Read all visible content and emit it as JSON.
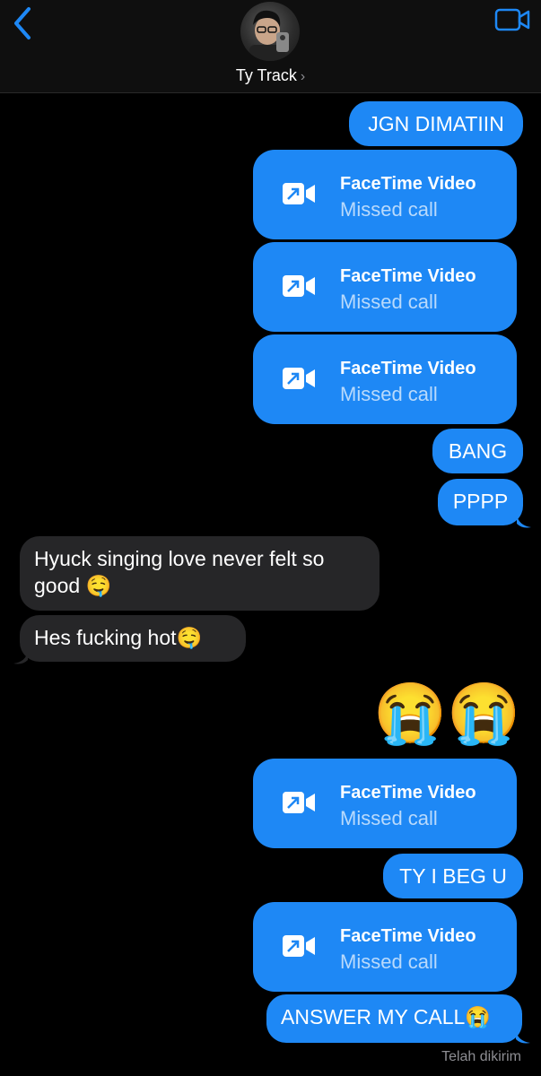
{
  "header": {
    "contact_name": "Ty Track",
    "chevron": "›",
    "back_icon": "chevron-left-icon",
    "video_icon": "video-camera-icon"
  },
  "messages": {
    "m1": "JGN DIMATIIN",
    "ft_title": "FaceTime Video",
    "ft_sub": "Missed call",
    "m5": "BANG",
    "m6": "PPPP",
    "in1_line1": "Hyuck singing love never felt so",
    "in1_line2": "good 🤤",
    "in2": "Hes fucking hot🤤",
    "emoji_row": "😭😭",
    "m9": "TY I BEG U",
    "m11": "ANSWER MY CALL😭"
  },
  "status": "Telah dikirim",
  "colors": {
    "outgoing": "#1e88f5",
    "incoming": "#262628",
    "background": "#000000",
    "accent": "#1e88f5"
  }
}
